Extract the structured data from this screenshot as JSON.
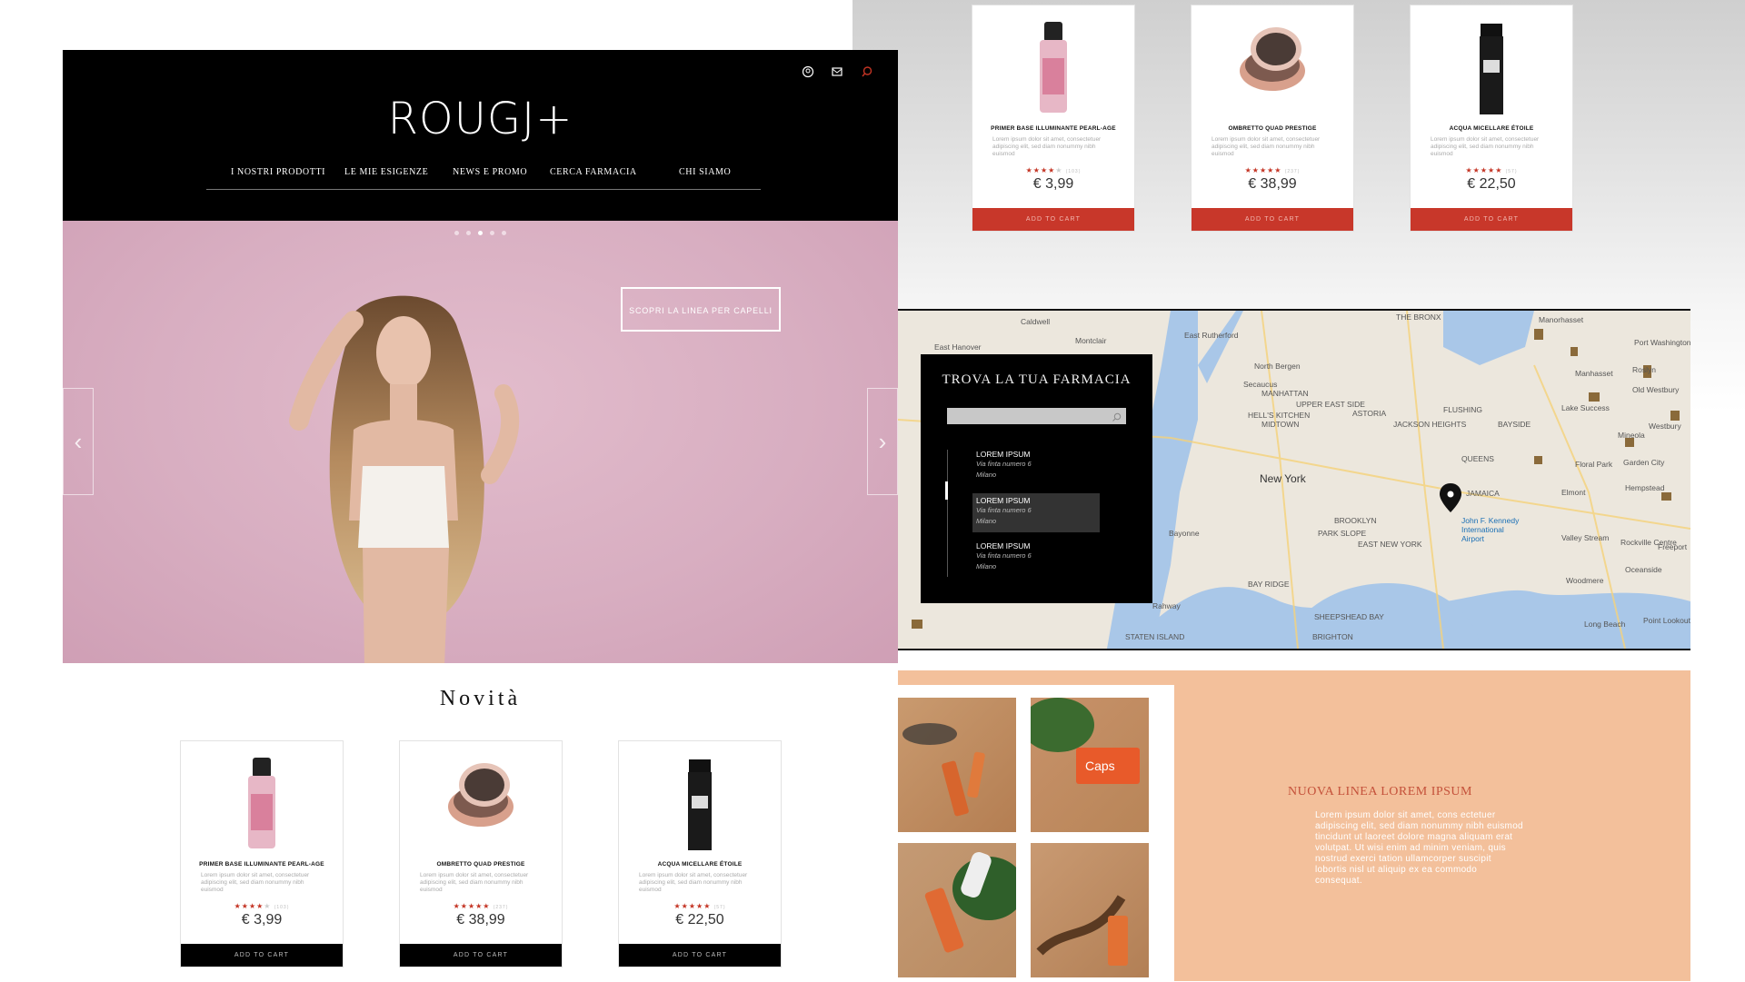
{
  "header": {
    "logo": "ROUGJ+",
    "nav": [
      "I NOSTRI PRODOTTI",
      "LE MIE ESIGENZE",
      "NEWS E PROMO",
      "CERCA FARMACIA",
      "CHI SIAMO"
    ],
    "icons": [
      "user-icon",
      "cart-icon",
      "search-icon"
    ],
    "accent": "#c43424"
  },
  "hero": {
    "cta": "SCOPRI LA LINEA PER CAPELLI",
    "slides": 5,
    "active_slide": 3
  },
  "novita": {
    "title": "Novità"
  },
  "products": [
    {
      "name": "PRIMER BASE ILLUMINANTE PEARL-AGE",
      "desc": "Lorem ipsum dolor sit amet, consectetuer adipiscing elit, sed diam nonummy nibh euismod",
      "rating": 4,
      "count": "(103)",
      "price": "€ 3,99"
    },
    {
      "name": "OMBRETTO QUAD PRESTIGE",
      "desc": "Lorem ipsum dolor sit amet, consectetuer adipiscing elit, sed diam nonummy nibh euismod",
      "rating": 5,
      "count": "(237)",
      "price": "€ 38,99"
    },
    {
      "name": "ACQUA MICELLARE ÉTOILE",
      "desc": "Lorem ipsum dolor sit amet, consectetuer adipiscing elit, sed diam nonummy nibh euismod",
      "rating": 5,
      "count": "(57)",
      "price": "€ 22,50"
    }
  ],
  "cart_label": "ADD TO CART",
  "cart_colors": {
    "bottom": "#000000",
    "top": "#c8372a"
  },
  "pharmacy": {
    "title": "TROVA LA TUA FARMACIA",
    "search_placeholder": "",
    "items": [
      {
        "name": "LOREM IPSUM",
        "addr": "Via finta numero 6",
        "city": "Milano"
      },
      {
        "name": "LOREM IPSUM",
        "addr": "Via finta numero 6",
        "city": "Milano"
      },
      {
        "name": "LOREM IPSUM",
        "addr": "Via finta numero 6",
        "city": "Milano"
      }
    ],
    "selected": 1
  },
  "map": {
    "labels": [
      "Caldwell",
      "East Hanover",
      "Montclair",
      "East Rutherford",
      "North Bergen",
      "Secaucus",
      "MANHATTAN",
      "UPPER EAST SIDE",
      "HELL'S KITCHEN",
      "MIDTOWN",
      "New York",
      "BROOKLYN",
      "PARK SLOPE",
      "QUEENS",
      "JAMAICA",
      "ASTORIA",
      "JACKSON HEIGHTS",
      "FLUSHING",
      "BAYSIDE",
      "Manorhasset",
      "Port Washington",
      "Lake Success",
      "Mineola",
      "Floral Park",
      "Garden City",
      "Hempstead",
      "Elmont",
      "Valley Stream",
      "Rockville Centre",
      "Freeport",
      "Oceanside",
      "Woodmere",
      "Long Beach",
      "Point Lookout",
      "Bayonne",
      "Rahway",
      "STATEN ISLAND",
      "SHEEPSHEAD BAY",
      "BRIGHTON",
      "John F. Kennedy International Airport",
      "EAST NEW YORK",
      "BAY RIDGE",
      "Westbury",
      "Roslyn",
      "Old Westbury",
      "Manhasset",
      "THE BRONX"
    ]
  },
  "promo": {
    "title": "NUOVA LINEA LOREM IPSUM",
    "text": "Lorem ipsum dolor sit amet, cons ectetuer adipiscing elit, sed diam nonummy nibh euismod tincidunt ut laoreet dolore magna aliquam erat volutpat. Ut wisi enim ad minim veniam, quis nostrud exerci tation ullamcorper suscipit lobortis nisl ut aliquip ex ea commodo consequat."
  }
}
